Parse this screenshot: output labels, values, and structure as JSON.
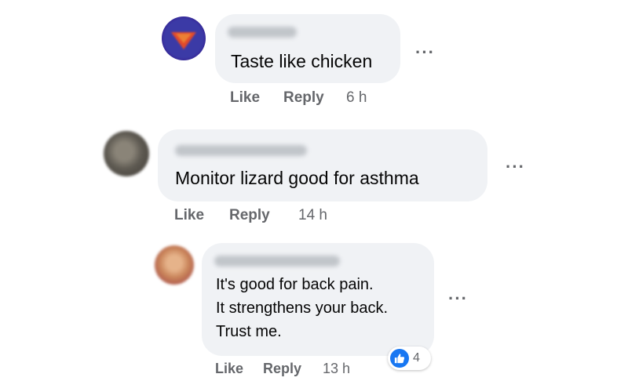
{
  "colors": {
    "bubble_bg": "#f0f2f5",
    "secondary_text": "#65676b",
    "like_blue": "#1877f2"
  },
  "comments": [
    {
      "author_blurred": "Eng K Lee",
      "text_lines": [
        "Taste like chicken"
      ],
      "actions": {
        "like": "Like",
        "reply": "Reply",
        "time": "6 h"
      },
      "more": "···"
    },
    {
      "author_blurred": "Bobby Kumaran",
      "text_lines": [
        "Monitor lizard good for asthma"
      ],
      "actions": {
        "like": "Like",
        "reply": "Reply",
        "time": "14 h"
      },
      "more": "···"
    },
    {
      "author_blurred": "Adnan Shahman",
      "text_lines": [
        "It's good for back pain.",
        "It strengthens your back.",
        "Trust me."
      ],
      "actions": {
        "like": "Like",
        "reply": "Reply",
        "time": "13 h"
      },
      "more": "···",
      "reactions": {
        "icon": "thumbs-up-icon",
        "count": "4"
      }
    }
  ]
}
